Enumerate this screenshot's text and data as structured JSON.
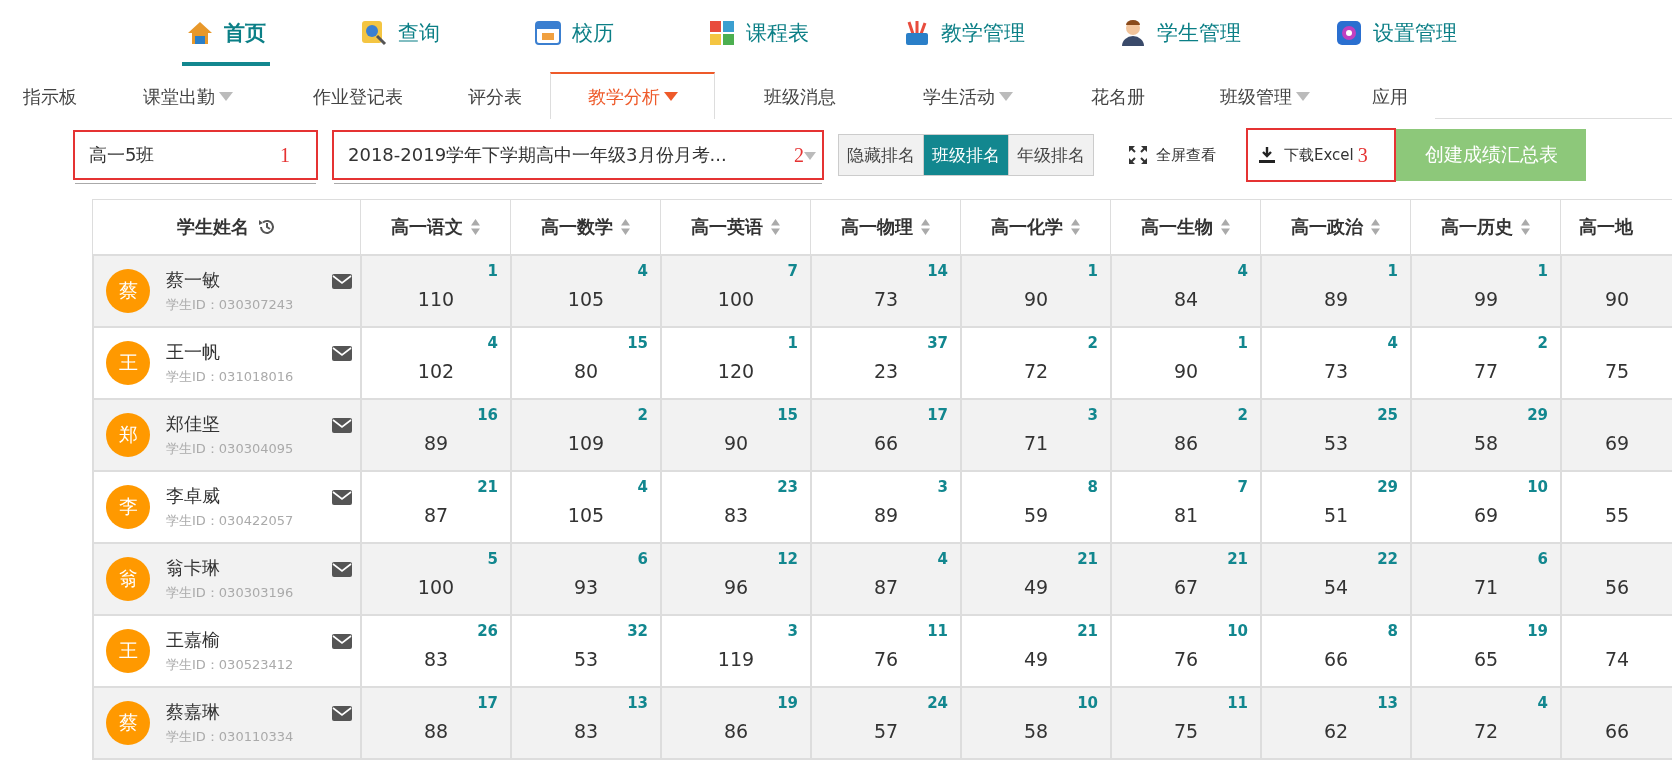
{
  "top_nav": [
    {
      "label": "首页",
      "selected": true
    },
    {
      "label": "查询",
      "selected": false
    },
    {
      "label": "校历",
      "selected": false
    },
    {
      "label": "课程表",
      "selected": false
    },
    {
      "label": "教学管理",
      "selected": false
    },
    {
      "label": "学生管理",
      "selected": false
    },
    {
      "label": "设置管理",
      "selected": false
    }
  ],
  "sub_tabs": [
    {
      "label": "指示板",
      "selected": false,
      "has_menu": false
    },
    {
      "label": "课堂出勤",
      "selected": false,
      "has_menu": true
    },
    {
      "label": "作业登记表",
      "selected": false,
      "has_menu": false
    },
    {
      "label": "评分表",
      "selected": false,
      "has_menu": false
    },
    {
      "label": "教学分析",
      "selected": true,
      "has_menu": true
    },
    {
      "label": "班级消息",
      "selected": false,
      "has_menu": false
    },
    {
      "label": "学生活动",
      "selected": false,
      "has_menu": true
    },
    {
      "label": "花名册",
      "selected": false,
      "has_menu": false
    },
    {
      "label": "班级管理",
      "selected": false,
      "has_menu": true
    },
    {
      "label": "应用",
      "selected": false,
      "has_menu": false
    }
  ],
  "toolbar": {
    "class_field": {
      "value": "高一5班",
      "annotation": "1"
    },
    "exam_select": {
      "value": "2018-2019学年下学期高中一年级3月份月考...",
      "annotation": "2"
    },
    "rank_toggle": [
      {
        "label": "隐藏排名",
        "selected": false
      },
      {
        "label": "班级排名",
        "selected": true
      },
      {
        "label": "年级排名",
        "selected": false
      }
    ],
    "fullscreen": "全屏查看",
    "download": {
      "label": "下载Excel",
      "annotation": "3"
    },
    "create": "创建成绩汇总表"
  },
  "table": {
    "columns": [
      "学生姓名",
      "高一语文",
      "高一数学",
      "高一英语",
      "高一物理",
      "高一化学",
      "高一生物",
      "高一政治",
      "高一历史",
      "高一地"
    ],
    "rows": [
      {
        "avatar": "蔡",
        "name": "蔡一敏",
        "id": "学生ID：030307243",
        "cells": [
          {
            "score": "110",
            "rank": "1"
          },
          {
            "score": "105",
            "rank": "4"
          },
          {
            "score": "100",
            "rank": "7"
          },
          {
            "score": "73",
            "rank": "14"
          },
          {
            "score": "90",
            "rank": "1"
          },
          {
            "score": "84",
            "rank": "4"
          },
          {
            "score": "89",
            "rank": "1"
          },
          {
            "score": "99",
            "rank": "1"
          },
          {
            "score": "90"
          }
        ]
      },
      {
        "avatar": "王",
        "name": "王一帆",
        "id": "学生ID：031018016",
        "cells": [
          {
            "score": "102",
            "rank": "4"
          },
          {
            "score": "80",
            "rank": "15"
          },
          {
            "score": "120",
            "rank": "1"
          },
          {
            "score": "23",
            "rank": "37"
          },
          {
            "score": "72",
            "rank": "2"
          },
          {
            "score": "90",
            "rank": "1"
          },
          {
            "score": "73",
            "rank": "4"
          },
          {
            "score": "77",
            "rank": "2"
          },
          {
            "score": "75"
          }
        ]
      },
      {
        "avatar": "郑",
        "name": "郑佳坚",
        "id": "学生ID：030304095",
        "cells": [
          {
            "score": "89",
            "rank": "16"
          },
          {
            "score": "109",
            "rank": "2"
          },
          {
            "score": "90",
            "rank": "15"
          },
          {
            "score": "66",
            "rank": "17"
          },
          {
            "score": "71",
            "rank": "3"
          },
          {
            "score": "86",
            "rank": "2"
          },
          {
            "score": "53",
            "rank": "25"
          },
          {
            "score": "58",
            "rank": "29"
          },
          {
            "score": "69"
          }
        ]
      },
      {
        "avatar": "李",
        "name": "李卓威",
        "id": "学生ID：030422057",
        "cells": [
          {
            "score": "87",
            "rank": "21"
          },
          {
            "score": "105",
            "rank": "4"
          },
          {
            "score": "83",
            "rank": "23"
          },
          {
            "score": "89",
            "rank": "3"
          },
          {
            "score": "59",
            "rank": "8"
          },
          {
            "score": "81",
            "rank": "7"
          },
          {
            "score": "51",
            "rank": "29"
          },
          {
            "score": "69",
            "rank": "10"
          },
          {
            "score": "55"
          }
        ]
      },
      {
        "avatar": "翁",
        "name": "翁卡琳",
        "id": "学生ID：030303196",
        "cells": [
          {
            "score": "100",
            "rank": "5"
          },
          {
            "score": "93",
            "rank": "6"
          },
          {
            "score": "96",
            "rank": "12"
          },
          {
            "score": "87",
            "rank": "4"
          },
          {
            "score": "49",
            "rank": "21"
          },
          {
            "score": "67",
            "rank": "21"
          },
          {
            "score": "54",
            "rank": "22"
          },
          {
            "score": "71",
            "rank": "6"
          },
          {
            "score": "56"
          }
        ]
      },
      {
        "avatar": "王",
        "name": "王嘉榆",
        "id": "学生ID：030523412",
        "cells": [
          {
            "score": "83",
            "rank": "26"
          },
          {
            "score": "53",
            "rank": "32"
          },
          {
            "score": "119",
            "rank": "3"
          },
          {
            "score": "76",
            "rank": "11"
          },
          {
            "score": "49",
            "rank": "21"
          },
          {
            "score": "76",
            "rank": "10"
          },
          {
            "score": "66",
            "rank": "8"
          },
          {
            "score": "65",
            "rank": "19"
          },
          {
            "score": "74"
          }
        ]
      },
      {
        "avatar": "蔡",
        "name": "蔡嘉琳",
        "id": "学生ID：030110334",
        "cells": [
          {
            "score": "88",
            "rank": "17"
          },
          {
            "score": "83",
            "rank": "13"
          },
          {
            "score": "86",
            "rank": "19"
          },
          {
            "score": "57",
            "rank": "24"
          },
          {
            "score": "58",
            "rank": "10"
          },
          {
            "score": "75",
            "rank": "11"
          },
          {
            "score": "62",
            "rank": "13"
          },
          {
            "score": "72",
            "rank": "4"
          },
          {
            "score": "66"
          }
        ]
      }
    ]
  }
}
